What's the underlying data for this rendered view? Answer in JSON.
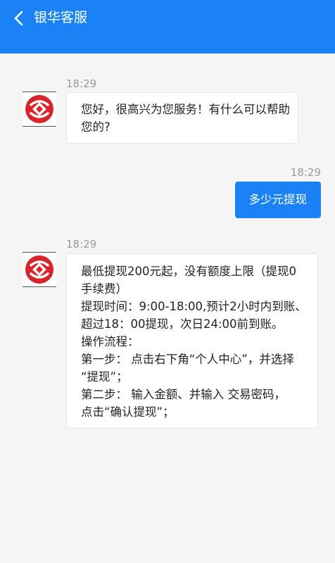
{
  "header": {
    "title": "银华客服",
    "back_icon": "chevron-left-icon",
    "background": "#1a82f5"
  },
  "messages": [
    {
      "sender": "agent",
      "time": "18:29",
      "avatar_icon": "bank-logo-icon",
      "lines": [
        "您好，很高兴为您服务！有什么可以帮助",
        "您的?"
      ]
    },
    {
      "sender": "user",
      "time": "18:29",
      "text": "多少元提现"
    },
    {
      "sender": "agent",
      "time": "18:29",
      "avatar_icon": "bank-logo-icon",
      "lines": [
        "最低提现200元起，没有额度上限（提现0",
        "手续费）",
        "提现时间：9:00-18:00,预计2小时内到账、",
        "超过18：00提现，次日24:00前到账。",
        "操作流程：",
        "第一步： 点击右下角“个人中心”，并选择",
        "“提现”；",
        "第二步： 输入金额、并输入 交易密码，",
        "点击“确认提现”；"
      ]
    }
  ],
  "colors": {
    "accent": "#1a82f5",
    "background": "#f5f5f5",
    "logo_red": "#d9242b"
  }
}
